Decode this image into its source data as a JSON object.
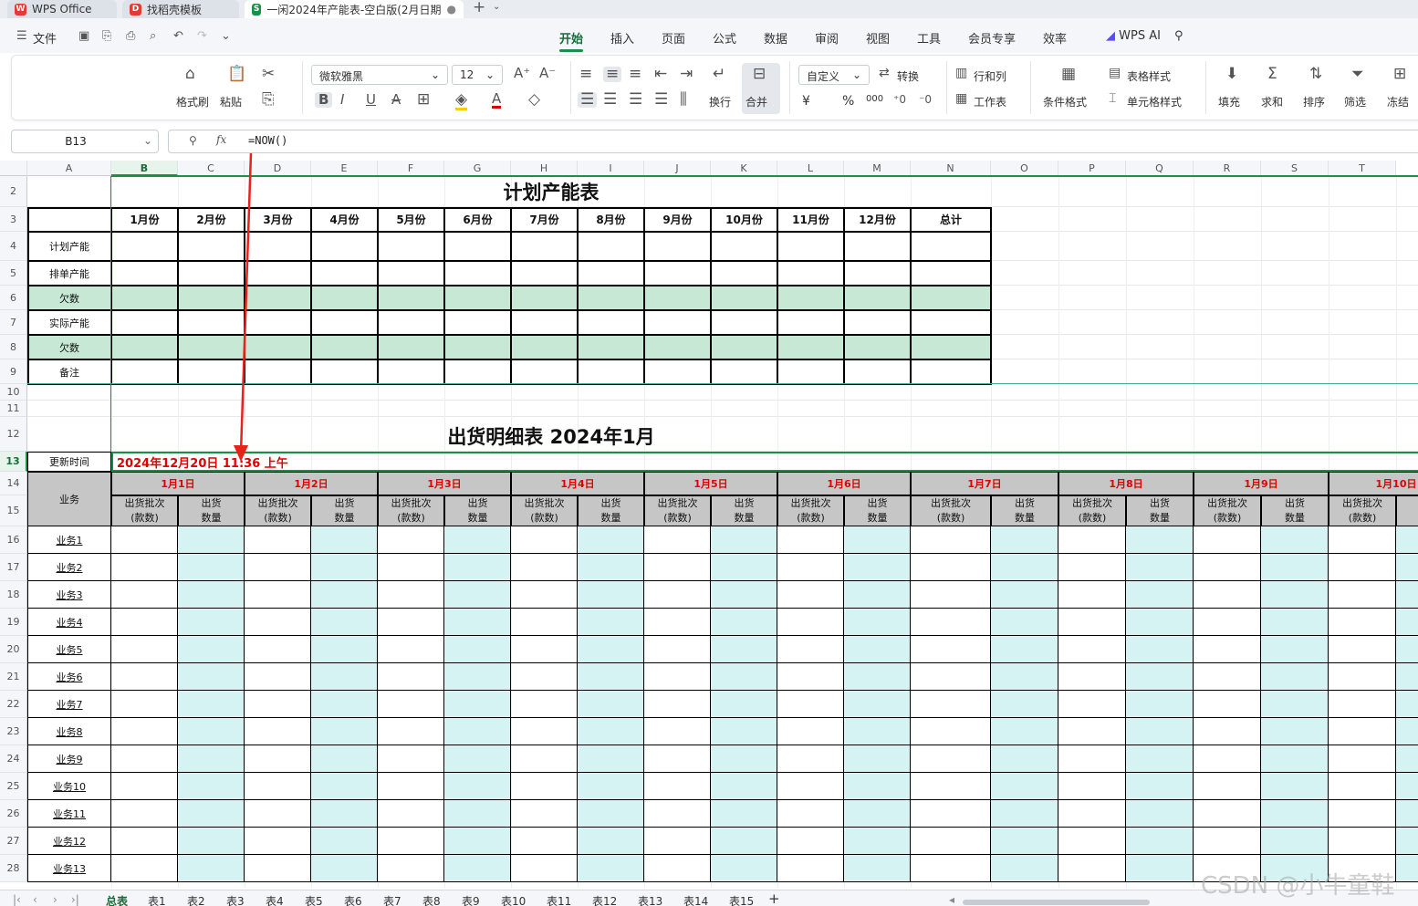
{
  "tabs": [
    {
      "label": "WPS Office",
      "icon": "wps-logo-icon"
    },
    {
      "label": "找稻壳模板",
      "icon": "docer-icon"
    },
    {
      "label": "一闲2024年产能表-空白版(2月日期",
      "icon": "spreadsheet-icon"
    }
  ],
  "menu": {
    "file": "文件",
    "items": [
      "开始",
      "插入",
      "页面",
      "公式",
      "数据",
      "审阅",
      "视图",
      "工具",
      "会员专享",
      "效率"
    ],
    "active": "开始",
    "wps_ai": "WPS AI"
  },
  "ribbon": {
    "format_painter": "格式刷",
    "paste": "粘贴",
    "font_name": "微软雅黑",
    "font_size": "12",
    "wrap": "换行",
    "merge": "合并",
    "number_format": "自定义",
    "convert": "转换",
    "row_col": "行和列",
    "worksheet": "工作表",
    "conditional_format": "条件格式",
    "table_style": "表格样式",
    "cell_style": "单元格样式",
    "fill": "填充",
    "sum": "求和",
    "sort": "排序",
    "filter": "筛选",
    "freeze": "冻结",
    "currency_symbol": "¥",
    "percent_symbol": "%",
    "thousands_symbol": "000",
    "accent_color": "#1a8f47",
    "font_color": "#e00000",
    "highlight_color": "#f5d000"
  },
  "formula_bar": {
    "name_box": "B13",
    "formula": "=NOW()"
  },
  "columns": [
    "A",
    "B",
    "C",
    "D",
    "E",
    "F",
    "G",
    "H",
    "I",
    "J",
    "K",
    "L",
    "M",
    "N",
    "O",
    "P",
    "Q",
    "R",
    "S",
    "T"
  ],
  "rows": [
    "2",
    "3",
    "4",
    "5",
    "6",
    "7",
    "8",
    "9",
    "10",
    "11",
    "12",
    "13",
    "14",
    "15",
    "16",
    "17",
    "18",
    "19",
    "20",
    "21",
    "22",
    "23",
    "24",
    "25",
    "26",
    "27",
    "28"
  ],
  "capacity": {
    "title": "计划产能表",
    "months": [
      "1月份",
      "2月份",
      "3月份",
      "4月份",
      "5月份",
      "6月份",
      "7月份",
      "8月份",
      "9月份",
      "10月份",
      "11月份",
      "12月份",
      "总计"
    ],
    "row_labels": [
      "计划产能",
      "排单产能",
      "欠数",
      "实际产能",
      "欠数",
      "备注"
    ]
  },
  "shipment": {
    "title": "出货明细表 2024年1月",
    "update_label": "更新时间",
    "update_value": "2024年12月20日 11:36 上午",
    "corner_label": "业务",
    "dates": [
      "1月1日",
      "1月2日",
      "1月3日",
      "1月4日",
      "1月5日",
      "1月6日",
      "1月7日",
      "1月8日",
      "1月9日",
      "1月10日"
    ],
    "sub_batch": [
      "出货批次",
      "(款数)"
    ],
    "sub_qty": [
      "出货",
      "数量"
    ],
    "businesses": [
      "业务1",
      "业务2",
      "业务3",
      "业务4",
      "业务5",
      "业务6",
      "业务7",
      "业务8",
      "业务9",
      "业务10",
      "业务11",
      "业务12",
      "业务13"
    ]
  },
  "sheet_tabs": [
    "总表",
    "表1",
    "表2",
    "表3",
    "表4",
    "表5",
    "表6",
    "表7",
    "表8",
    "表9",
    "表10",
    "表11",
    "表12",
    "表13",
    "表14",
    "表15"
  ],
  "active_sheet": "总表",
  "watermark": "CSDN @小牛童鞋"
}
